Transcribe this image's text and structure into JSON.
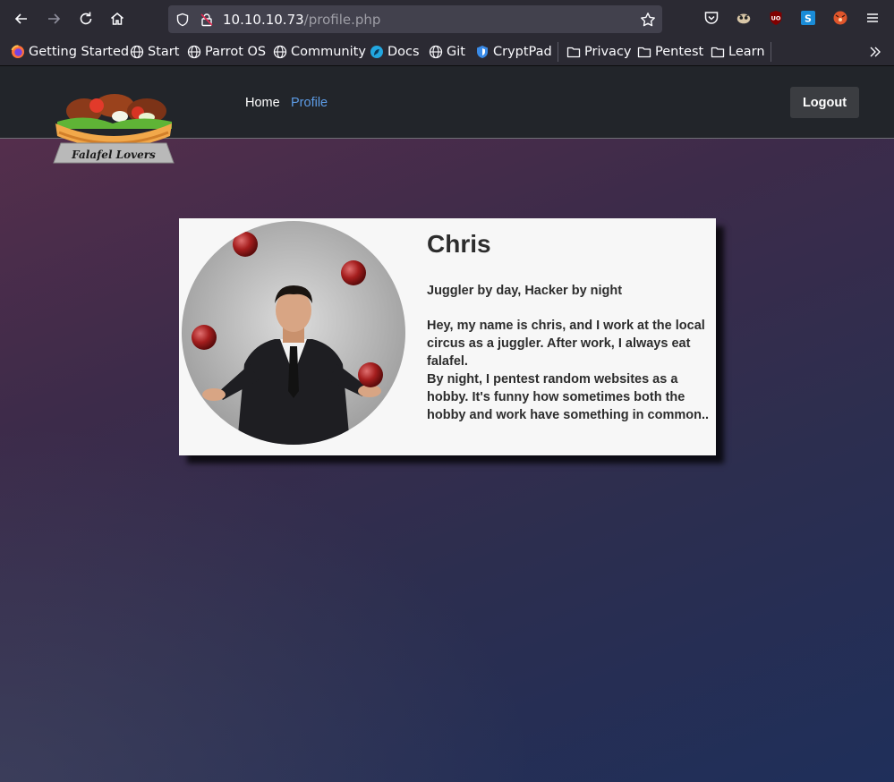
{
  "browser": {
    "url_host": "10.10.10.73",
    "url_path": "/profile.php",
    "bookmarks": [
      {
        "label": "Getting Started",
        "icon": "firefox-icon"
      },
      {
        "label": "Start",
        "icon": "globe-icon"
      },
      {
        "label": "Parrot OS",
        "icon": "globe-icon"
      },
      {
        "label": "Community",
        "icon": "globe-icon"
      },
      {
        "label": "Docs",
        "icon": "parrot-docs-icon"
      },
      {
        "label": "Git",
        "icon": "globe-icon"
      },
      {
        "label": "CryptPad",
        "icon": "cryptpad-icon"
      },
      {
        "label": "Privacy",
        "icon": "folder-icon"
      },
      {
        "label": "Pentest",
        "icon": "folder-icon"
      },
      {
        "label": "Learn",
        "icon": "folder-icon"
      }
    ]
  },
  "site": {
    "logo_text": "Falafel Lovers",
    "nav": {
      "home": "Home",
      "profile": "Profile"
    },
    "logout": "Logout",
    "colors": {
      "active_link": "#5d9ce6",
      "navbar": "#22252a"
    }
  },
  "profile": {
    "name": "Chris",
    "tagline": "Juggler by day, Hacker by night",
    "bio_lines": [
      "Hey, my name is chris, and I work at the local circus as a juggler. After work, I always eat falafel.",
      "By night, I pentest random websites as a hobby. It's funny how sometimes both the hobby and work have something in common.."
    ]
  }
}
